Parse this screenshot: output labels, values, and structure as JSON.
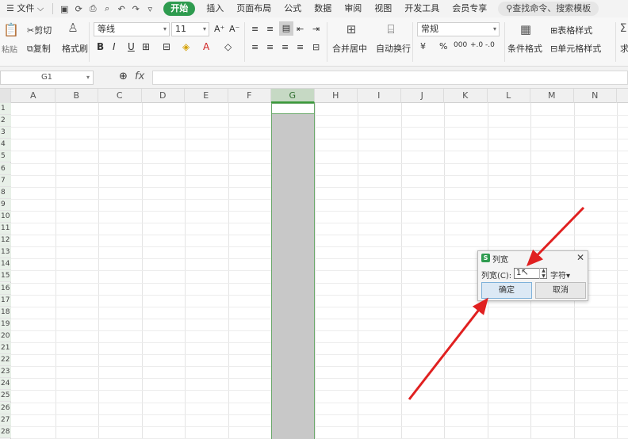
{
  "menubar": {
    "file_label": "文件",
    "tabs": [
      "开始",
      "插入",
      "页面布局",
      "公式",
      "数据",
      "审阅",
      "视图",
      "开发工具",
      "会员专享"
    ],
    "active_tab": "开始",
    "search_placeholder": "查找命令、搜索模板"
  },
  "ribbon": {
    "paste_label": "粘贴",
    "cut_label": "剪切",
    "copy_label": "复制",
    "format_painter_label": "格式刷",
    "font_name": "等线",
    "font_size": "11",
    "merge_label": "合并居中",
    "wrap_label": "自动换行",
    "number_format": "常规",
    "cond_format_label": "条件格式",
    "table_style_label": "表格样式",
    "cell_style_label": "单元格样式",
    "sum_label": "求"
  },
  "formula_bar": {
    "cell_ref": "G1",
    "fx_label": "fx",
    "content": ""
  },
  "grid": {
    "columns": [
      "A",
      "B",
      "C",
      "D",
      "E",
      "F",
      "G",
      "H",
      "I",
      "J",
      "K",
      "L",
      "M",
      "N"
    ],
    "selected_column": "G",
    "rows": [
      "1",
      "2",
      "3",
      "4",
      "5",
      "6",
      "7",
      "8",
      "9",
      "10",
      "11",
      "12",
      "13",
      "14",
      "15",
      "16",
      "17",
      "18",
      "19",
      "20",
      "21",
      "22",
      "23",
      "24",
      "25",
      "26",
      "27",
      "28"
    ]
  },
  "dialog": {
    "title": "列宽",
    "field_label": "列宽(C):",
    "field_value": "1",
    "unit_label": "字符",
    "ok_label": "确定",
    "cancel_label": "取消",
    "logo_letter": "S"
  },
  "colors": {
    "accent_green": "#2e9b4f",
    "annotation_red": "#e02020",
    "selection_gray": "#c8c8c8"
  }
}
